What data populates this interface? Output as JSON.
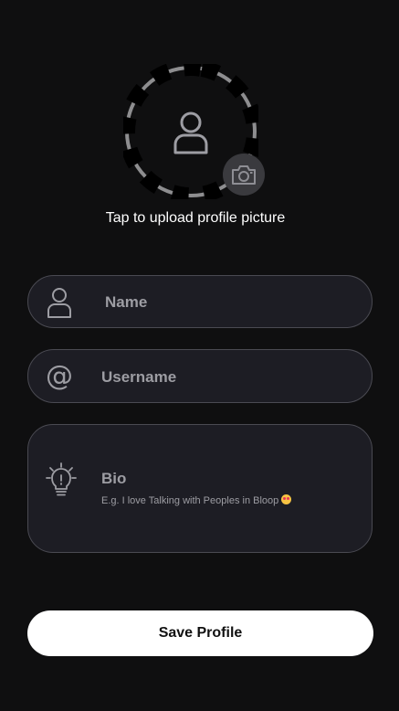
{
  "avatar": {
    "caption": "Tap to upload profile picture",
    "person_icon": "person-icon",
    "camera_icon": "camera-icon"
  },
  "form": {
    "name": {
      "placeholder": "Name",
      "icon": "person-icon"
    },
    "username": {
      "placeholder": "Username",
      "icon": "at-icon",
      "icon_glyph": "@"
    },
    "bio": {
      "label": "Bio",
      "placeholder": "E.g. I love Talking with Peoples in Bloop",
      "icon": "lightbulb-icon"
    }
  },
  "save_button": {
    "label": "Save Profile"
  },
  "colors": {
    "background": "#0f0f10",
    "field_bg": "#1d1d24",
    "field_border": "#4a4a52",
    "muted_text": "#9d9da3",
    "button_bg": "#ffffff"
  }
}
